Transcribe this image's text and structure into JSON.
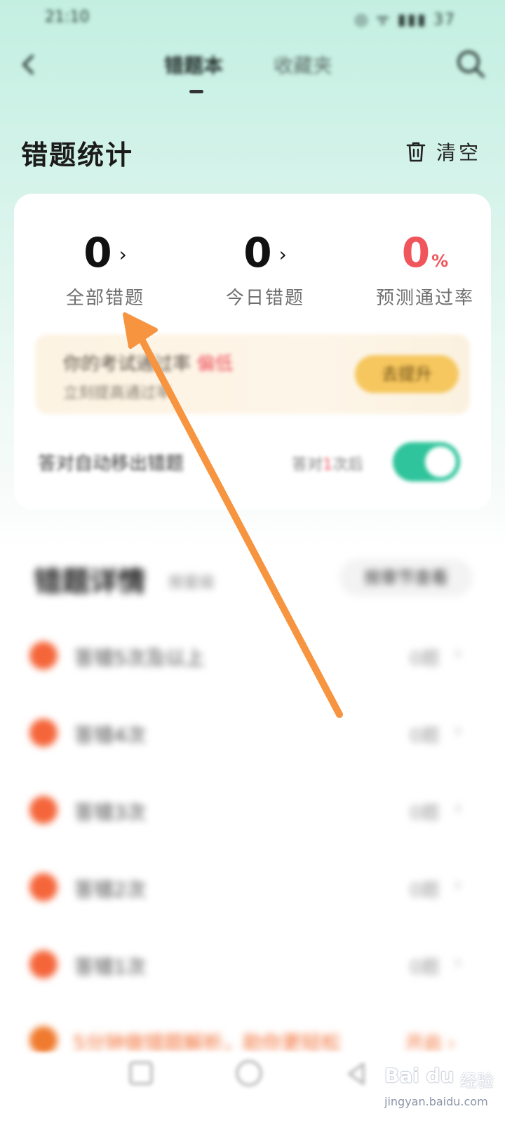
{
  "status_bar": {
    "time": "21:10",
    "icons": "◎ ᯤ ▮▮▮ 37"
  },
  "nav": {
    "tabs": [
      {
        "label": "错题本"
      },
      {
        "label": "收藏夹"
      }
    ]
  },
  "stats_section": {
    "title": "错题统计",
    "clear_label": "清空"
  },
  "stats": {
    "all": {
      "value": "0",
      "chevron": "›",
      "label": "全部错题"
    },
    "today": {
      "value": "0",
      "chevron": "›",
      "label": "今日错题"
    },
    "pass_rate": {
      "value": "0",
      "unit": "%",
      "label": "预测通过率"
    }
  },
  "promo": {
    "line1_prefix": "你的考试通过率 ",
    "line1_highlight": "偏低",
    "line2": "立刻提高通过率",
    "button": "去提升"
  },
  "auto_remove": {
    "label": "答对自动移出错题",
    "hint_prefix": "答对",
    "hint_highlight": "1",
    "hint_suffix": "次后",
    "enabled": true
  },
  "details": {
    "title": "错题详情",
    "subtitle": "按星级",
    "button": "按章节查看"
  },
  "list": [
    {
      "label": "答错5次及以上",
      "count": "0题",
      "chevron": "›"
    },
    {
      "label": "答错4次",
      "count": "0题",
      "chevron": "›"
    },
    {
      "label": "答错3次",
      "count": "0题",
      "chevron": "›"
    },
    {
      "label": "答错2次",
      "count": "0题",
      "chevron": "›"
    },
    {
      "label": "答错1次",
      "count": "0题",
      "chevron": "›"
    }
  ],
  "bottom_banner": {
    "text": "5分钟做错题解析，助你更轻松",
    "right": "开启 ›"
  },
  "watermark": {
    "logo": "Bai du",
    "cn": "经验",
    "url": "jingyan.baidu.com"
  },
  "colors": {
    "accent_green": "#2fc49b",
    "accent_red": "#f0555c",
    "accent_orange": "#f5653a",
    "promo_yellow": "#f6c75e",
    "arrow_orange": "#f79440"
  }
}
